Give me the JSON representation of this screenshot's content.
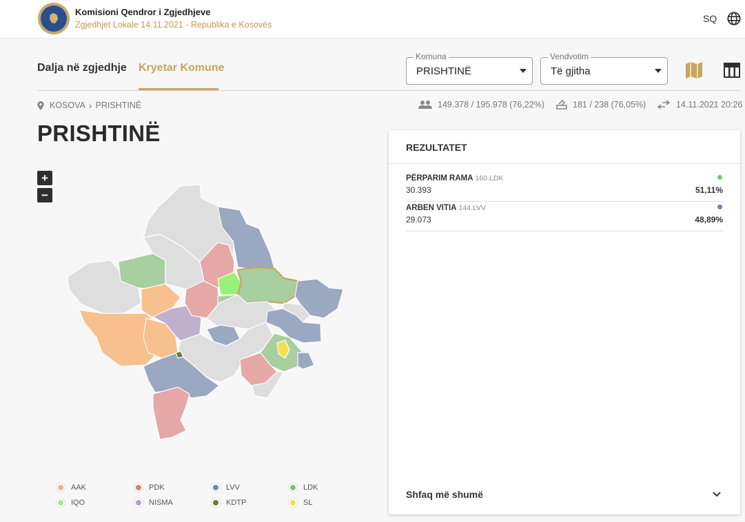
{
  "header": {
    "title": "Komisioni Qendror i Zgjedhjeve",
    "subtitle": "Zgjedhjet Lokale 14.11.2021 - Republika e Kosovës",
    "language": "SQ"
  },
  "tabs": [
    {
      "label": "Dalja në zgjedhje",
      "active": false
    },
    {
      "label": "Kryetar Komune",
      "active": true
    }
  ],
  "filters": {
    "municipality": {
      "legend": "Komuna",
      "value": "PRISHTINË"
    },
    "polling": {
      "legend": "Vendvotim",
      "value": "Të gjitha"
    }
  },
  "breadcrumb": [
    "KOSOVA",
    "PRISHTINË"
  ],
  "stats": {
    "turnout": "149.378 / 195.978 (76,22%)",
    "stations": "181 / 238 (76,05%)",
    "updated": "14.11.2021 20:26"
  },
  "page_title": "PRISHTINË",
  "zoom": {
    "in": "+",
    "out": "−"
  },
  "legend": [
    {
      "label": "AAK",
      "color": "#f5b479"
    },
    {
      "label": "PDK",
      "color": "#e07b7b"
    },
    {
      "label": "LVV",
      "color": "#6f85ab"
    },
    {
      "label": "LDK",
      "color": "#7fbf7f"
    },
    {
      "label": "IQO",
      "color": "#9bf07a"
    },
    {
      "label": "NISMA",
      "color": "#b9a3c9"
    },
    {
      "label": "KDTP",
      "color": "#6b7a3c"
    },
    {
      "label": "SL",
      "color": "#f0e050"
    }
  ],
  "results": {
    "title": "REZULTATET",
    "candidates": [
      {
        "name": "PËRPARIM RAMA",
        "party": "160.LDK",
        "votes": "30.393",
        "percent": "51,11%",
        "color": "#7fbf7f"
      },
      {
        "name": "ARBEN VITIA",
        "party": "144.LVV",
        "votes": "29.073",
        "percent": "48,89%",
        "color": "#6f85ab"
      }
    ],
    "show_more": "Shfaq më shumë"
  },
  "colors": {
    "accent": "#c9a45e"
  }
}
